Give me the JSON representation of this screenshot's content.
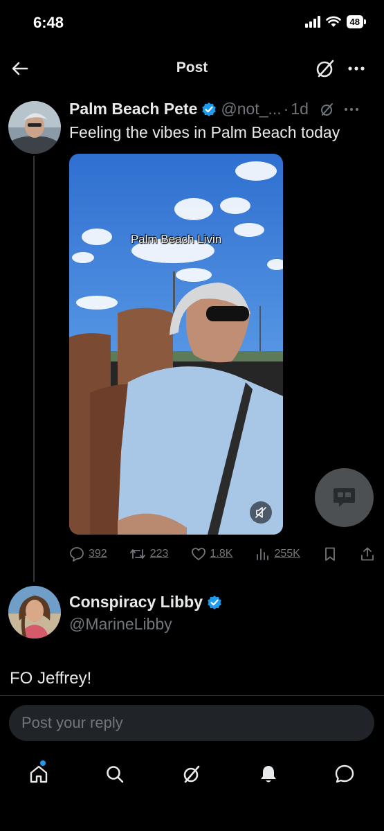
{
  "status_bar": {
    "time": "6:48",
    "battery": "48"
  },
  "nav": {
    "title": "Post"
  },
  "tweet": {
    "author_name": "Palm Beach Pete",
    "author_handle": "@not_...",
    "time": "1d",
    "text": "Feeling the vibes in Palm Beach today",
    "media_caption": "Palm Beach Livin",
    "stats": {
      "replies": "392",
      "reposts": "223",
      "likes": "1.8K",
      "views": "255K"
    }
  },
  "reply": {
    "author_name": "Conspiracy Libby",
    "author_handle": "@MarineLibby",
    "text": "FO Jeffrey!"
  },
  "composer": {
    "placeholder": "Post your reply"
  },
  "colors": {
    "accent": "#1d9bf0",
    "muted": "#71767b",
    "background": "#000000"
  },
  "icons": [
    "back-arrow-icon",
    "grok-icon",
    "more-icon",
    "verified-icon",
    "reply-icon",
    "repost-icon",
    "like-icon",
    "views-icon",
    "bookmark-icon",
    "share-icon",
    "mute-icon",
    "home-icon",
    "search-icon",
    "notifications-icon",
    "messages-icon"
  ]
}
